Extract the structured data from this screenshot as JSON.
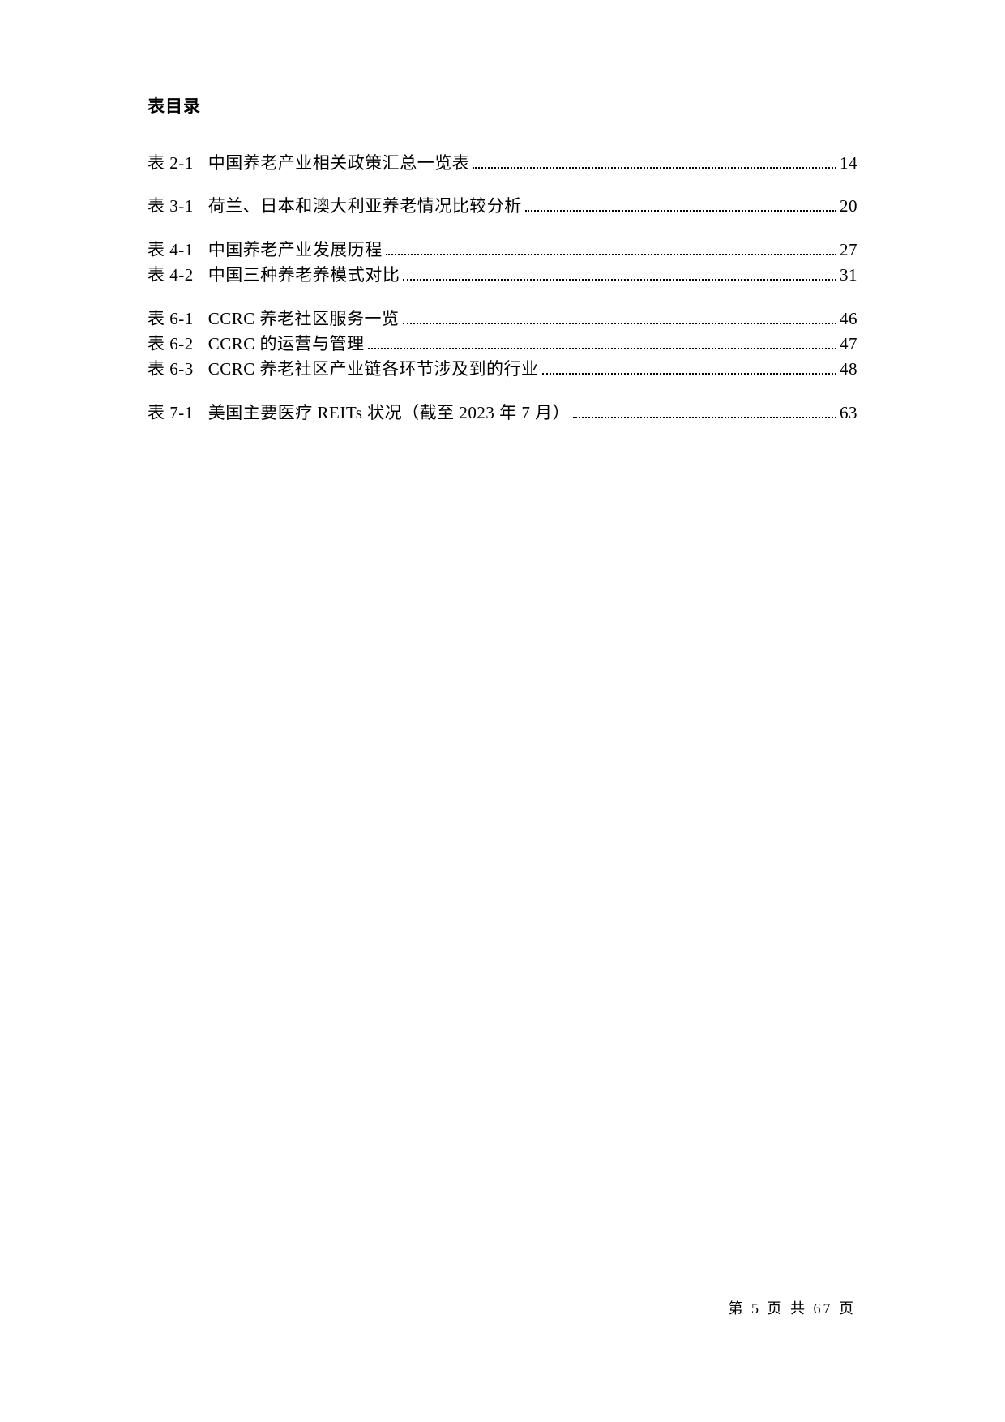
{
  "heading": "表目录",
  "groups": [
    {
      "entries": [
        {
          "label": "表 2-1",
          "title": "中国养老产业相关政策汇总一览表",
          "page": "14"
        }
      ]
    },
    {
      "entries": [
        {
          "label": "表 3-1",
          "title": "荷兰、日本和澳大利亚养老情况比较分析",
          "page": "20"
        }
      ]
    },
    {
      "entries": [
        {
          "label": "表 4-1",
          "title": "中国养老产业发展历程",
          "page": "27"
        },
        {
          "label": "表 4-2",
          "title": "中国三种养老养模式对比",
          "page": "31"
        }
      ]
    },
    {
      "entries": [
        {
          "label": "表 6-1",
          "title": "CCRC 养老社区服务一览",
          "page": "46"
        },
        {
          "label": "表 6-2",
          "title": "CCRC 的运营与管理",
          "page": "47"
        },
        {
          "label": "表 6-3",
          "title": "CCRC 养老社区产业链各环节涉及到的行业",
          "page": "48"
        }
      ]
    },
    {
      "entries": [
        {
          "label": "表 7-1",
          "title": "美国主要医疗 REITs 状况（截至 2023 年 7 月）",
          "page": "63"
        }
      ]
    }
  ],
  "footer": {
    "prefix": "第",
    "current": "5",
    "mid": "页 共",
    "total": "67",
    "suffix": "页"
  }
}
